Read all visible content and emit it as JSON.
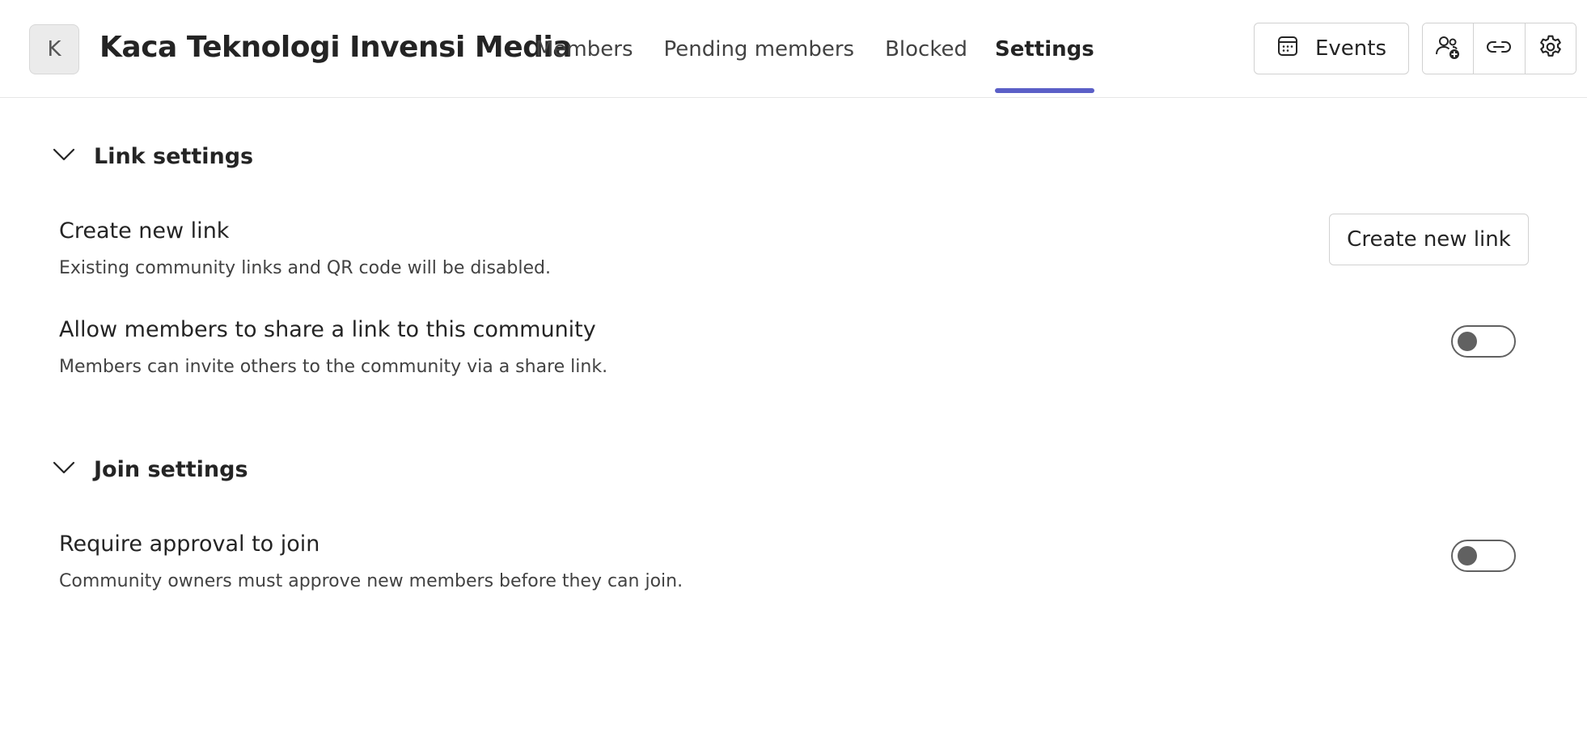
{
  "header": {
    "avatar_initial": "K",
    "community_name": "Kaca Teknologi Invensi Media",
    "tabs": [
      {
        "label": "Members",
        "active": false
      },
      {
        "label": "Pending members",
        "active": false
      },
      {
        "label": "Blocked",
        "active": false
      },
      {
        "label": "Settings",
        "active": true
      }
    ],
    "events_label": "Events",
    "icons": [
      "add-member-icon",
      "link-icon",
      "gear-icon"
    ],
    "accent_color": "#5b5fc7"
  },
  "sections": {
    "link_settings": {
      "title": "Link settings",
      "create_link": {
        "title": "Create new link",
        "description": "Existing community links and QR code will be disabled.",
        "button_label": "Create new link"
      },
      "allow_share": {
        "title": "Allow members to share a link to this community",
        "description": "Members can invite others to the community via a share link.",
        "enabled": false
      }
    },
    "join_settings": {
      "title": "Join settings",
      "require_approval": {
        "title": "Require approval to join",
        "description": "Community owners must approve new members before they can join.",
        "enabled": false
      }
    }
  }
}
